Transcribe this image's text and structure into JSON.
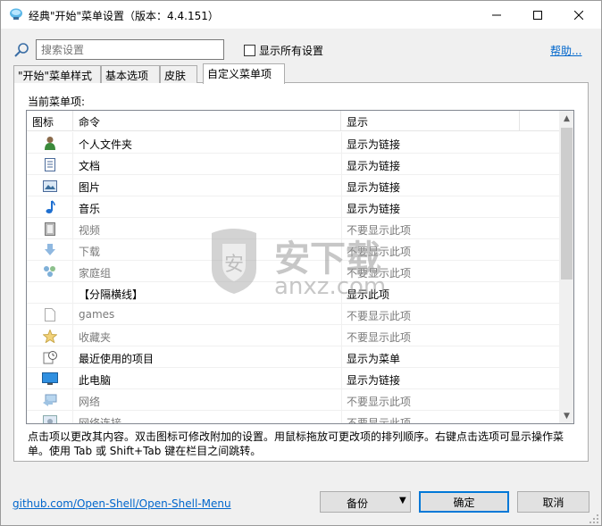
{
  "window": {
    "title": "经典\"开始\"菜单设置（版本：4.4.151）"
  },
  "toolbar": {
    "search_placeholder": "搜索设置",
    "show_all_label": "显示所有设置",
    "help_label": "帮助..."
  },
  "tabs": [
    {
      "label": "\"开始\"菜单样式"
    },
    {
      "label": "基本选项"
    },
    {
      "label": "皮肤"
    },
    {
      "label": "自定义菜单项"
    }
  ],
  "list": {
    "caption": "当前菜单项:",
    "columns": [
      "图标",
      "命令",
      "显示"
    ],
    "rows": [
      {
        "icon": "user-folder-icon",
        "command": "个人文件夹",
        "display": "显示为链接",
        "dim": false
      },
      {
        "icon": "document-icon",
        "command": "文档",
        "display": "显示为链接",
        "dim": false
      },
      {
        "icon": "picture-icon",
        "command": "图片",
        "display": "显示为链接",
        "dim": false
      },
      {
        "icon": "music-note-icon",
        "command": "音乐",
        "display": "显示为链接",
        "dim": false
      },
      {
        "icon": "video-icon",
        "command": "视频",
        "display": "不要显示此项",
        "dim": true
      },
      {
        "icon": "download-arrow-icon",
        "command": "下载",
        "display": "不要显示此项",
        "dim": true
      },
      {
        "icon": "homegroup-icon",
        "command": "家庭组",
        "display": "不要显示此项",
        "dim": true
      },
      {
        "icon": "",
        "command": "【分隔横线】",
        "display": "显示此项",
        "dim": false
      },
      {
        "icon": "blank-page-icon",
        "command": "games",
        "display": "不要显示此项",
        "dim": true
      },
      {
        "icon": "star-icon",
        "command": "收藏夹",
        "display": "不要显示此项",
        "dim": true
      },
      {
        "icon": "recent-items-icon",
        "command": "最近使用的项目",
        "display": "显示为菜单",
        "dim": false
      },
      {
        "icon": "computer-icon",
        "command": "此电脑",
        "display": "显示为链接",
        "dim": false
      },
      {
        "icon": "network-icon",
        "command": "网络",
        "display": "不要显示此项",
        "dim": true
      },
      {
        "icon": "network-connections-icon",
        "command": "网络连接",
        "display": "不要显示此项",
        "dim": true
      }
    ]
  },
  "hint": "点击项以更改其内容。双击图标可修改附加的设置。用鼠标拖放可更改项的排列顺序。右键点击选项可显示操作菜单。使用 Tab 或 Shift+Tab 键在栏目之间跳转。",
  "footer": {
    "link": "github.com/Open-Shell/Open-Shell-Menu",
    "backup_label": "备份",
    "ok_label": "确定",
    "cancel_label": "取消"
  },
  "watermark": {
    "text": "anxz.com",
    "cn": "安下载"
  },
  "colors": {
    "accent": "#0078d7",
    "link": "#0066cc",
    "dim_text": "#7a7a7a"
  }
}
